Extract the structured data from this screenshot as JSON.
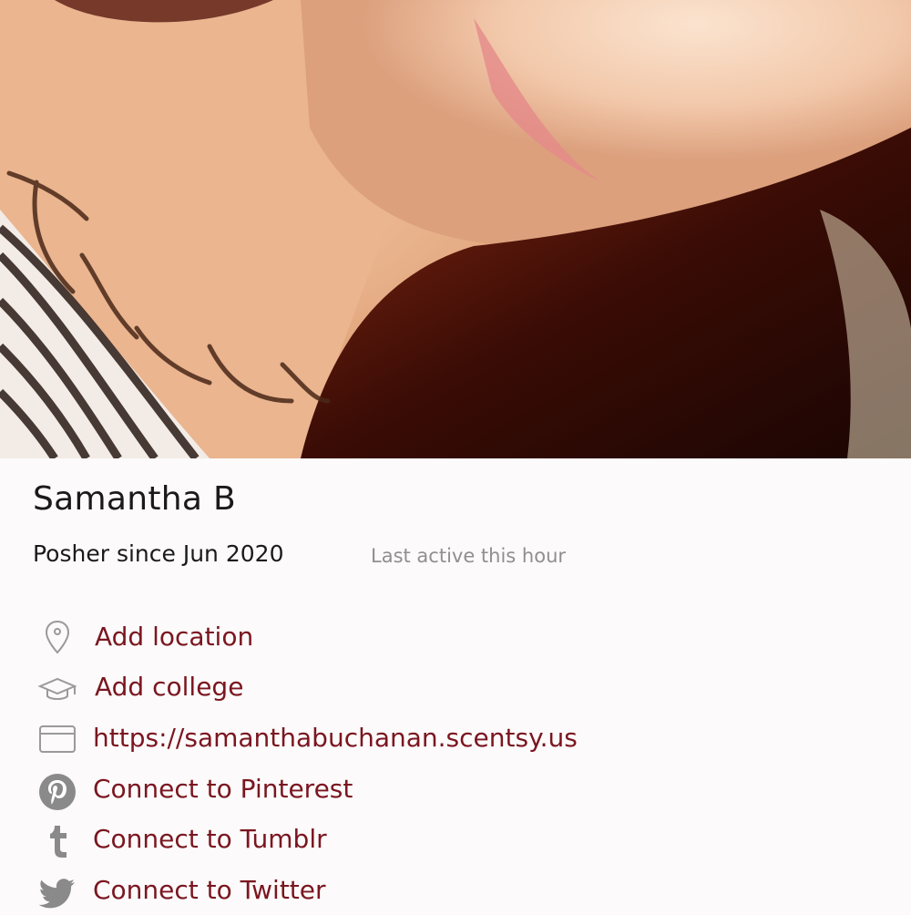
{
  "profile": {
    "name": "Samantha B",
    "posher_since": "Posher since Jun 2020",
    "last_active": "Last active this hour"
  },
  "links": [
    {
      "icon": "location-pin-icon",
      "label": "Add location"
    },
    {
      "icon": "graduation-cap-icon",
      "label": "Add college"
    },
    {
      "icon": "browser-window-icon",
      "label": "https://samanthabuchanan.scentsy.us"
    },
    {
      "icon": "pinterest-icon",
      "label": "Connect to Pinterest"
    },
    {
      "icon": "tumblr-icon",
      "label": "Connect to Tumblr"
    },
    {
      "icon": "twitter-icon",
      "label": "Connect to Twitter"
    }
  ],
  "colors": {
    "link": "#7a1620",
    "muted": "#8f8f8f",
    "icon": "#9a9a9a",
    "background": "#fcfafa"
  }
}
